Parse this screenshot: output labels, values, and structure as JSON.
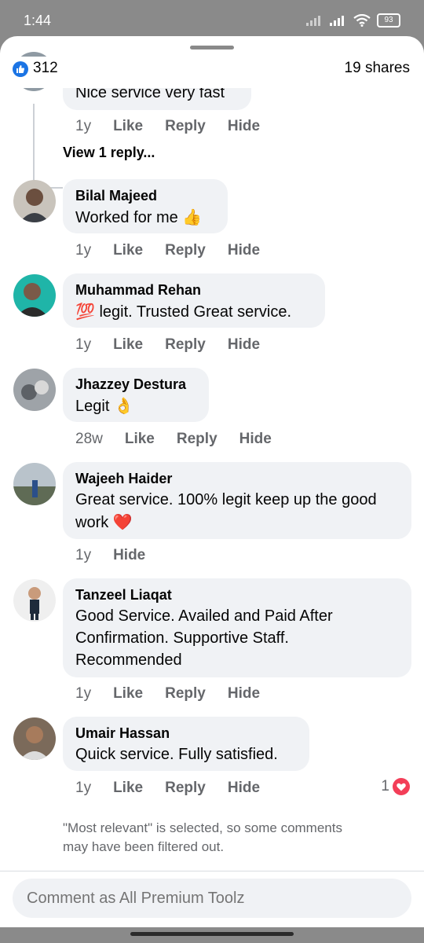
{
  "status": {
    "time": "1:44",
    "battery": "93"
  },
  "header": {
    "likes": "312",
    "shares": "19 shares"
  },
  "prev_reply": {
    "text": "Nice service very fast",
    "time": "1y",
    "like": "Like",
    "reply": "Reply",
    "hide": "Hide",
    "view_replies": "View 1 reply..."
  },
  "comments": [
    {
      "author": "Bilal Majeed",
      "text": "Worked for me",
      "emoji": "👍",
      "time": "1y",
      "like": "Like",
      "reply": "Reply",
      "hide": "Hide"
    },
    {
      "author": "Muhammad Rehan",
      "text": "legit. Trusted Great service.",
      "emoji_prefix": "💯",
      "time": "1y",
      "like": "Like",
      "reply": "Reply",
      "hide": "Hide"
    },
    {
      "author": "Jhazzey Destura",
      "text": "Legit",
      "emoji": "👌",
      "time": "28w",
      "like": "Like",
      "reply": "Reply",
      "hide": "Hide"
    },
    {
      "author": "Wajeeh Haider",
      "text": "Great service. 100% legit keep up the good work",
      "emoji": "❤️",
      "time": "1y",
      "hide": "Hide"
    },
    {
      "author": "Tanzeel Liaqat",
      "text": "Good Service. Availed and Paid After Confirmation. Supportive Staff. Recommended",
      "time": "1y",
      "like": "Like",
      "reply": "Reply",
      "hide": "Hide"
    },
    {
      "author": "Umair Hassan",
      "text": "Quick service. Fully satisfied.",
      "time": "1y",
      "like": "Like",
      "reply": "Reply",
      "hide": "Hide",
      "reactions": "1"
    }
  ],
  "footer": {
    "note": "\"Most relevant\" is selected, so some comments may have been filtered out."
  },
  "input": {
    "placeholder": "Comment as All Premium Toolz"
  },
  "colors": {
    "accent": "#1b74e4",
    "heart": "#f33e58",
    "bubble": "#f0f2f5"
  }
}
